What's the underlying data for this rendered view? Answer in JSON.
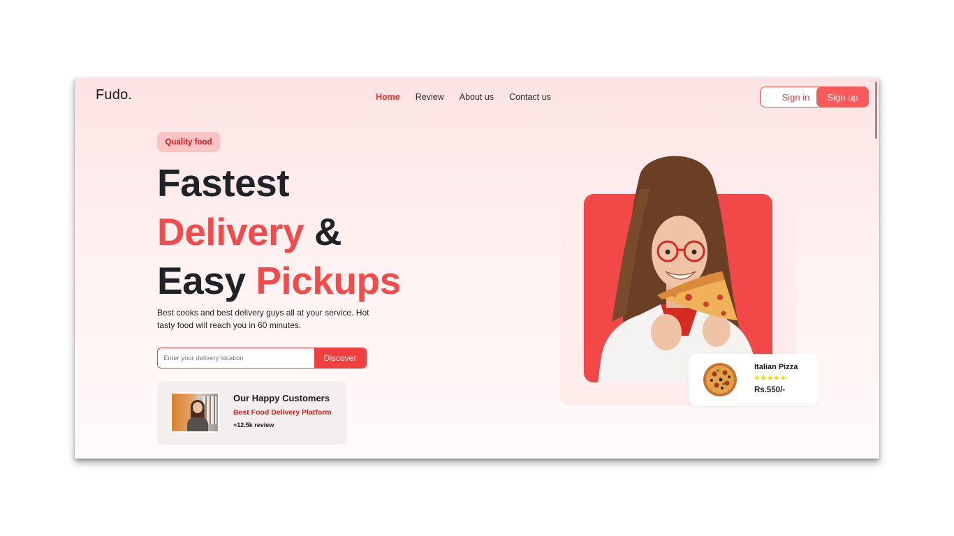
{
  "header": {
    "logo": "Fudo.",
    "nav": [
      {
        "label": "Home",
        "active": true
      },
      {
        "label": "Review",
        "active": false
      },
      {
        "label": "About us",
        "active": false
      },
      {
        "label": "Contact us",
        "active": false
      }
    ],
    "signin_label": "Sign in",
    "signup_label": "Sign up"
  },
  "hero": {
    "badge": "Quality food",
    "headline": {
      "line1": "Fastest",
      "line2_red": "Delivery",
      "line2_dark": "&",
      "line3_dark": "Easy",
      "line3_red": "Pickups"
    },
    "description": "Best cooks and best delivery guys all at your service. Hot tasty food will reach you in 60 minutes.",
    "search": {
      "placeholder": "Enter your delivery location",
      "value": "",
      "button_label": "Discover"
    }
  },
  "customers": {
    "title": "Our Happy Customers",
    "subtitle": "Best Food Delivery Platform",
    "reviews": "+12.5k review"
  },
  "product_card": {
    "name": "Italian Pizza",
    "rating": 5,
    "stars": "★★★★★",
    "price": "Rs.550/-"
  },
  "colors": {
    "accent": "#f14b4b",
    "accent_dark": "#e8181b",
    "badge_bg": "#fbc4c4",
    "star": "#f7d21b",
    "text": "#1f2328"
  }
}
